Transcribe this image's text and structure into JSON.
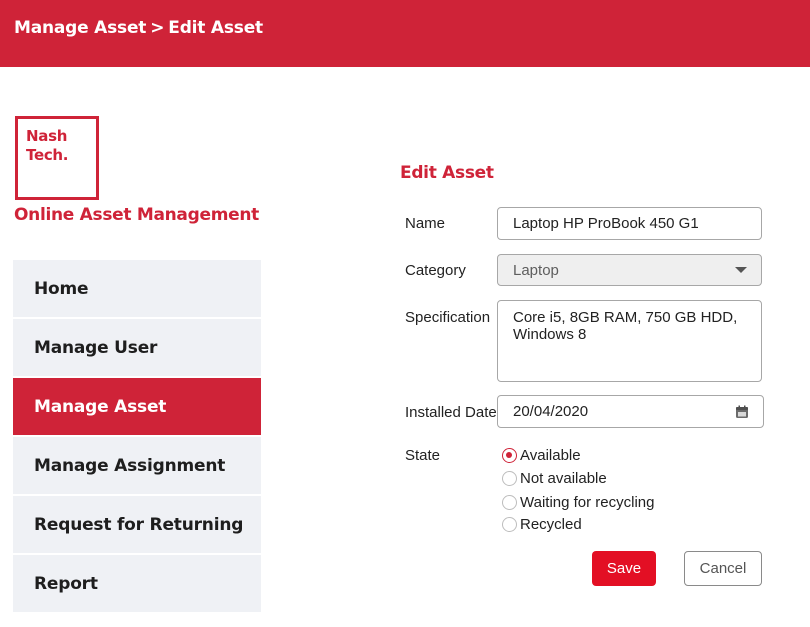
{
  "header": {
    "breadcrumb_root": "Manage Asset",
    "breadcrumb_separator": ">",
    "breadcrumb_current": "Edit Asset"
  },
  "brand": {
    "logo_line1": "Nash",
    "logo_line2": "Tech.",
    "app_title": "Online Asset Management",
    "accent_color": "#cf2338"
  },
  "nav": {
    "items": [
      {
        "label": "Home"
      },
      {
        "label": "Manage User"
      },
      {
        "label": "Manage Asset",
        "active": true
      },
      {
        "label": "Manage Assignment"
      },
      {
        "label": "Request for Returning"
      },
      {
        "label": "Report"
      }
    ]
  },
  "form": {
    "title": "Edit Asset",
    "name_label": "Name",
    "name_value": "Laptop HP ProBook 450 G1",
    "category_label": "Category",
    "category_value": "Laptop",
    "category_icon": "chevron-down-icon",
    "specification_label": "Specification",
    "specification_value": "Core i5, 8GB RAM, 750 GB HDD,\nWindows 8",
    "installed_date_label": "Installed Date",
    "installed_date_value": "20/04/2020",
    "calendar_icon": "calendar-icon",
    "state_label": "State",
    "state_options": [
      {
        "label": "Available",
        "checked": true
      },
      {
        "label": "Not available",
        "checked": false
      },
      {
        "label": "Waiting for recycling",
        "checked": false
      },
      {
        "label": "Recycled",
        "checked": false
      }
    ],
    "save_label": "Save",
    "cancel_label": "Cancel"
  }
}
